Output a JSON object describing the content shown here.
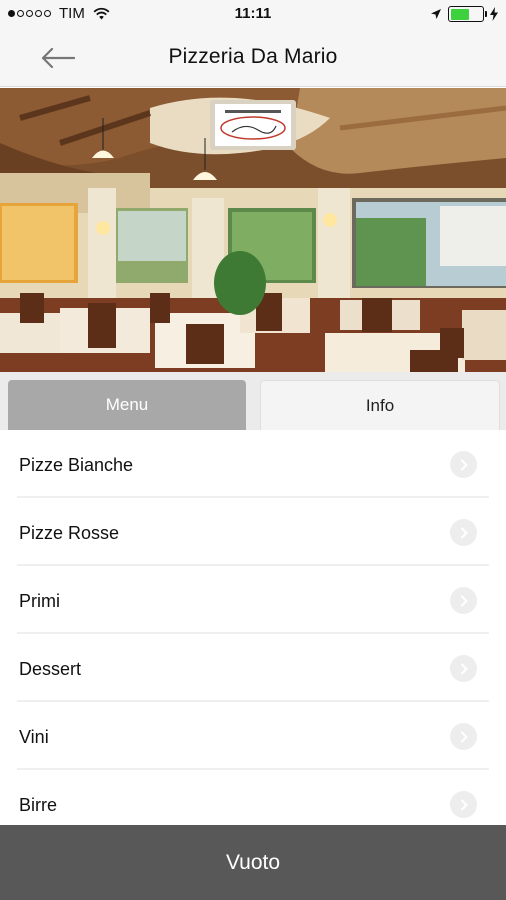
{
  "status_bar": {
    "carrier": "TIM",
    "time": "11:11",
    "signal_filled": 1,
    "signal_total": 5,
    "battery_level": 0.6,
    "icons": [
      "signal-dots-icon",
      "wifi-icon",
      "location-arrow-icon",
      "battery-icon",
      "charging-bolt-icon"
    ]
  },
  "nav": {
    "back_icon": "back-arrow-icon",
    "title": "Pizzeria Da Mario"
  },
  "hero": {
    "image_semantic": "restaurant-dining-room-photo",
    "logo_semantic": "restaurant-logo"
  },
  "tabs": [
    {
      "label": "Menu",
      "active": true
    },
    {
      "label": "Info",
      "active": false
    }
  ],
  "menu": {
    "items": [
      {
        "label": "Pizze Bianche"
      },
      {
        "label": "Pizze Rosse"
      },
      {
        "label": "Primi"
      },
      {
        "label": "Dessert"
      },
      {
        "label": "Vini"
      },
      {
        "label": "Birre"
      }
    ],
    "item_icon": "chevron-right-circle-icon"
  },
  "cart": {
    "label": "Vuoto"
  },
  "colors": {
    "active_tab": "#a8a8a8",
    "bottom_bar": "#585858",
    "battery": "#3dd13d"
  }
}
